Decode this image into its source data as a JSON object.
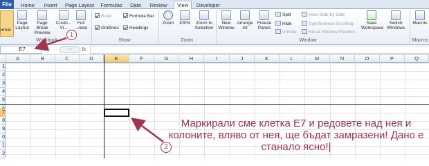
{
  "tabs": [
    "File",
    "Home",
    "Insert",
    "Page Layout",
    "Formulas",
    "Data",
    "Review",
    "View",
    "Developer"
  ],
  "active_tab": "View",
  "ribbon": {
    "normal_label": "ormal",
    "page_layout": "Page Layout",
    "page_break": "Page Break Preview",
    "custom_views": "Custo... Vi...",
    "full_screen": "Full ...reen",
    "workbook_group_label": "Workbook",
    "ruler": "Ruler",
    "gridlines": "Gridlines",
    "formula_bar": "Formula Bar",
    "headings": "Headings",
    "show_group_label": "Show",
    "zoom": "Zoom",
    "zoom100": "100%",
    "zoom_to_selection": "Zoom to Selection",
    "zoom_group_label": "Zoom",
    "new_window": "New Window",
    "arrange_all": "Arrange All",
    "freeze_panes": "Freeze Panes",
    "split": "Split",
    "hide": "Hide",
    "unhide": "Unhide",
    "view_side_by_side": "View Side by Side",
    "synchronous_scrolling": "Synchronous Scrolling",
    "reset_window_position": "Reset Window Position",
    "window_group_label": "Window",
    "save_workspace": "Save Workspace",
    "switch_windows": "Switch Windows",
    "macros": "Macros",
    "macros_group_label": "Macros"
  },
  "formula_bar": {
    "name_box": "E7",
    "fx": "fx",
    "dots": "◦◦◦",
    "value": ""
  },
  "columns": [
    "A",
    "B",
    "C",
    "D",
    "E",
    "F",
    "G",
    "H",
    "I",
    "J",
    "K",
    "L",
    "M",
    "N",
    "O",
    "P",
    "Q"
  ],
  "selected_column": "E",
  "rows": [
    "1",
    "2",
    "3",
    "4",
    "5",
    "6",
    "7",
    "8",
    "9",
    "0",
    "1",
    "2"
  ],
  "selected_row": "7",
  "annotations": {
    "callout1": "1",
    "callout2": "2",
    "note": "Маркирали сме клетка E7 и редовете над нея и колоните, вляво от нея, ще бъдат замразени! Дано е станало ясно!|",
    "color": "#a3344f"
  }
}
